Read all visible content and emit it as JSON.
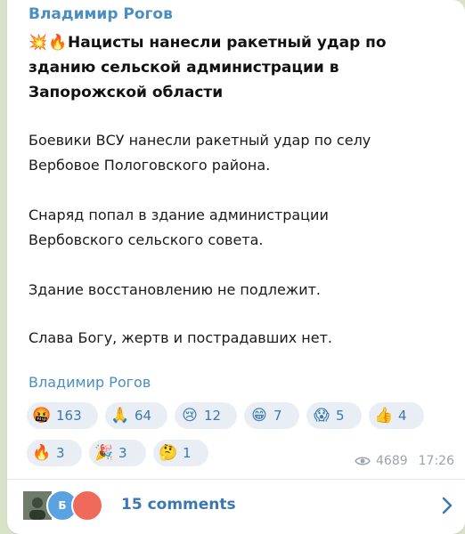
{
  "post": {
    "author": "Владимир Рогов",
    "title_emoji": [
      "💥",
      "🔥"
    ],
    "title_lines": [
      "Нацисты нанесли ракетный удар по",
      "зданию сельской администрации в",
      "Запорожской области"
    ],
    "paragraphs": [
      [
        "Боевики ВСУ нанесли ракетный удар по селу",
        "Вербовое Пологовского района."
      ],
      [
        "Снаряд попал в здание администрации",
        "Вербовского сельского совета."
      ],
      [
        "Здание восстановлению не подлежит."
      ],
      [
        "Слава Богу, жертв и пострадавших нет."
      ]
    ],
    "signature": "Владимир Рогов"
  },
  "reactions": [
    {
      "emoji": "🤬",
      "count": "163"
    },
    {
      "emoji": "🙏",
      "count": "64"
    },
    {
      "emoji": "😢",
      "count": "12"
    },
    {
      "emoji": "😁",
      "count": "7"
    },
    {
      "emoji": "😱",
      "count": "5"
    },
    {
      "emoji": "👍",
      "count": "4"
    },
    {
      "emoji": "🔥",
      "count": "3"
    },
    {
      "emoji": "🎉",
      "count": "3"
    },
    {
      "emoji": "🤔",
      "count": "1"
    }
  ],
  "meta": {
    "views": "4689",
    "time": "17:26",
    "views_icon": "eye-icon"
  },
  "comments": {
    "label": "15 comments",
    "avatars": [
      {
        "letter": "",
        "color": "#5c6b5a"
      },
      {
        "letter": "Б",
        "color": "#5aa3e0"
      },
      {
        "letter": "",
        "color": "#ef6a5a"
      }
    ],
    "chevron_icon": "chevron-right-icon"
  },
  "colors": {
    "link": "#4a8ec4",
    "reaction_bg": "#e9eef5",
    "reaction_text": "#3b78b0",
    "background": "#d7e2c8"
  }
}
